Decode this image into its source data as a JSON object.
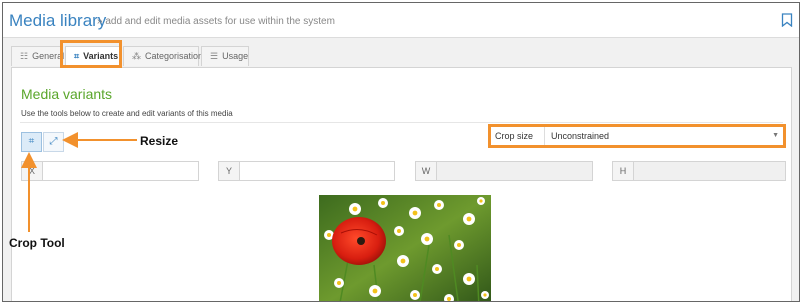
{
  "header": {
    "title": "Media library",
    "subtitle": "» add and edit media assets for use within the system"
  },
  "tabs": [
    {
      "label": "General",
      "icon": "sliders-icon",
      "active": false
    },
    {
      "label": "Variants",
      "icon": "crop-icon",
      "active": true
    },
    {
      "label": "Categorisation",
      "icon": "hierarchy-icon",
      "active": false
    },
    {
      "label": "Usage",
      "icon": "list-icon",
      "active": false
    }
  ],
  "section": {
    "title": "Media variants",
    "description": "Use the tools below to create and edit variants of this media"
  },
  "tools": [
    {
      "name": "crop-tool",
      "icon": "crop-icon"
    },
    {
      "name": "resize-tool",
      "icon": "resize-icon"
    }
  ],
  "crop": {
    "label": "Crop size",
    "value": "Unconstrained"
  },
  "coords": [
    {
      "label": "X",
      "value": ""
    },
    {
      "label": "Y",
      "value": ""
    },
    {
      "label": "W",
      "value": ""
    },
    {
      "label": "H",
      "value": ""
    }
  ],
  "annotations": {
    "resize": "Resize",
    "crop_tool": "Crop Tool"
  },
  "colors": {
    "accent": "#3a83c0",
    "section_title": "#5aa62b",
    "highlight": "#f2912d"
  }
}
